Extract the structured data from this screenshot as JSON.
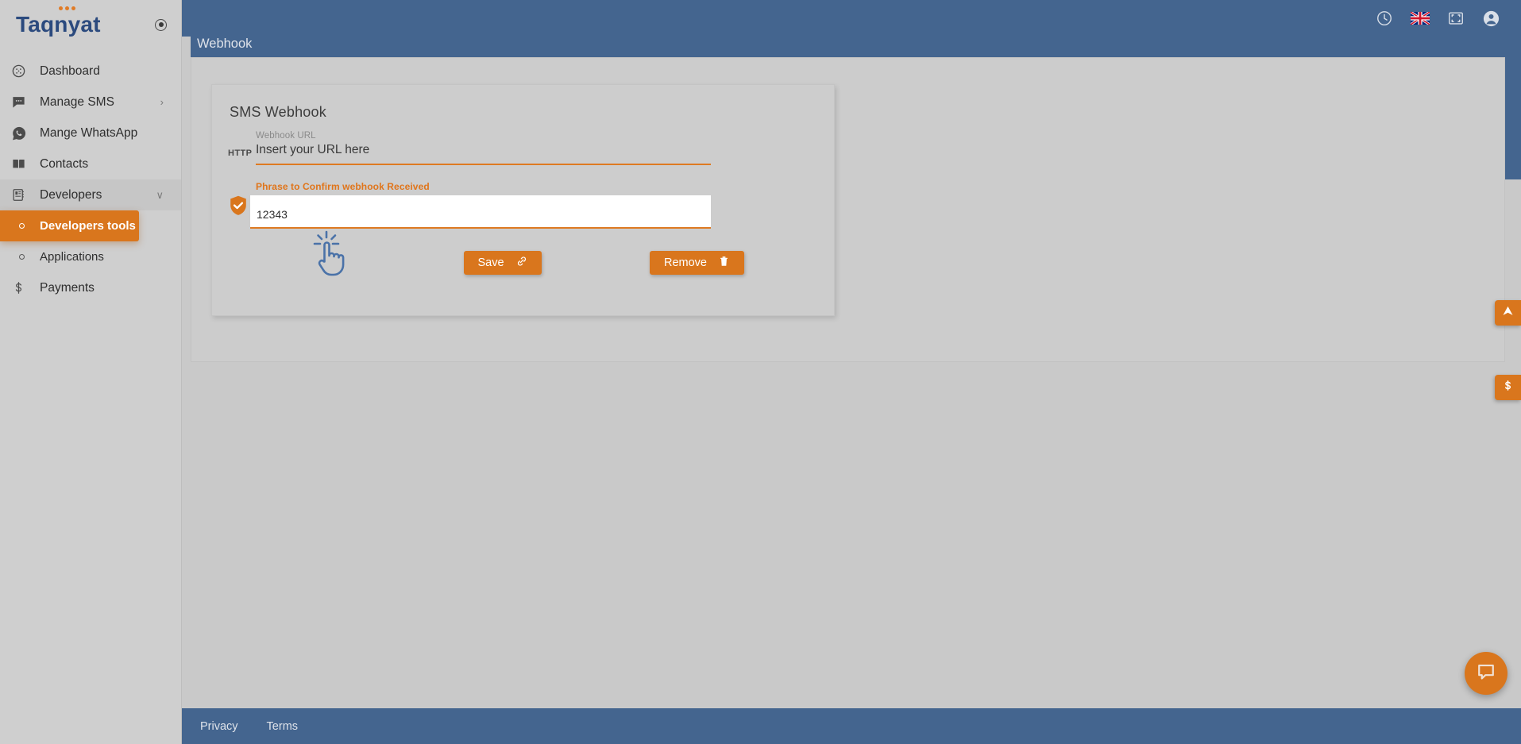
{
  "brand": {
    "name": "Taqnyat",
    "toggle_icon": "collapse-toggle-icon"
  },
  "sidebar": {
    "items": [
      {
        "label": "Dashboard",
        "icon": "dashboard-icon",
        "state": "normal",
        "chevron": ""
      },
      {
        "label": "Manage SMS",
        "icon": "sms-chat-icon",
        "state": "normal",
        "chevron": "›"
      },
      {
        "label": "Mange WhatsApp",
        "icon": "whatsapp-icon",
        "state": "normal",
        "chevron": ""
      },
      {
        "label": "Contacts",
        "icon": "book-icon",
        "state": "normal",
        "chevron": ""
      },
      {
        "label": "Developers",
        "icon": "notebook-icon",
        "state": "highlight",
        "chevron": "∨"
      },
      {
        "label": "Developers tools",
        "icon": "circle-dot-icon",
        "state": "active",
        "chevron": ""
      },
      {
        "label": "Applications",
        "icon": "circle-dot-icon",
        "state": "sub",
        "chevron": ""
      },
      {
        "label": "Payments",
        "icon": "dollar-icon",
        "state": "normal",
        "chevron": ""
      }
    ]
  },
  "header": {
    "page_title": "Webhook",
    "icons": [
      {
        "name": "history-clock-icon"
      },
      {
        "name": "uk-flag-icon"
      },
      {
        "name": "fullscreen-icon"
      },
      {
        "name": "user-account-icon"
      }
    ]
  },
  "card": {
    "title": "SMS Webhook",
    "webhook_url_label": "Webhook URL",
    "http_tag": "HTTP",
    "url_placeholder": "Insert your URL here",
    "url_value": "",
    "phrase_label": "Phrase to Confirm webhook Received",
    "phrase_value": "12343",
    "phrase_placeholder": "",
    "shield_icon": "shield-check-icon",
    "save_label": "Save",
    "save_icon": "link-chain-icon",
    "remove_label": "Remove",
    "remove_icon": "trash-icon"
  },
  "side_tabs": [
    {
      "name": "send-tab",
      "icon": "paper-plane-icon"
    },
    {
      "name": "balance-tab",
      "icon": "dollar-icon"
    }
  ],
  "chat": {
    "icon": "speech-bubble-icon"
  },
  "footer": {
    "privacy": "Privacy",
    "terms": "Terms"
  },
  "colors": {
    "accent_orange": "#d9761d",
    "underline_orange": "#de7a22",
    "header_blue": "#44658f",
    "brand_blue": "#2b4a7e",
    "sidebar_gray": "#cfcfcf",
    "panel_gray": "#cccccc",
    "cursor_blue": "#4a72a8"
  },
  "cursor": {
    "name": "click-hand-cursor"
  }
}
